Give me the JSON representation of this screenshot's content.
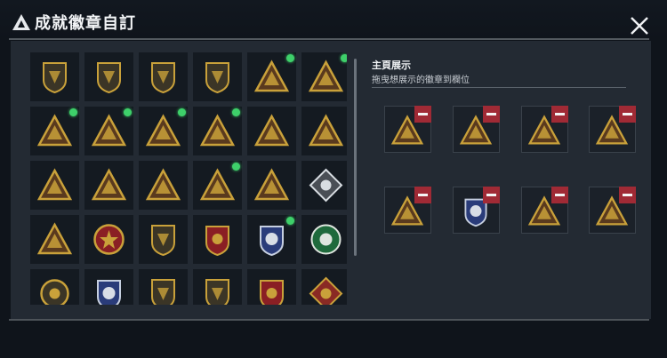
{
  "header": {
    "title": "成就徽章自訂"
  },
  "showcase": {
    "title": "主頁展示",
    "subtitle": "拖曳想展示的徽章到欄位"
  },
  "colors": {
    "gold": "#c9a13a",
    "panel": "#232a33",
    "new_dot": "#3ed06a",
    "remove": "#a02a35"
  },
  "badge_grid": [
    {
      "icon": "shield-delta-icon",
      "new": false
    },
    {
      "icon": "shield-helicopter-icon",
      "new": false
    },
    {
      "icon": "shield-diamond-icon",
      "new": false
    },
    {
      "icon": "shield-arrows-icon",
      "new": false
    },
    {
      "icon": "triangle-trophy-56-icon",
      "new": true
    },
    {
      "icon": "triangle-canister-icon",
      "new": true
    },
    {
      "icon": "triangle-card-56-icon",
      "new": true
    },
    {
      "icon": "triangle-turret-icon",
      "new": true
    },
    {
      "icon": "triangle-chain-icon",
      "new": true
    },
    {
      "icon": "triangle-helmet-icon",
      "new": true
    },
    {
      "icon": "triangle-number-one-icon",
      "new": false
    },
    {
      "icon": "triangle-bag-icon",
      "new": false
    },
    {
      "icon": "triangle-soldier-icon",
      "new": false
    },
    {
      "icon": "triangle-crosshair-icon",
      "new": false
    },
    {
      "icon": "triangle-squad-icon",
      "new": false
    },
    {
      "icon": "triangle-rocket-icon",
      "new": true
    },
    {
      "icon": "triangle-arm-icon",
      "new": false
    },
    {
      "icon": "diamond-skull-icon",
      "new": false
    },
    {
      "icon": "triangle-gunner-icon",
      "new": false
    },
    {
      "icon": "round-star-medal-icon",
      "new": false
    },
    {
      "icon": "shield-plate-icon",
      "new": false
    },
    {
      "icon": "shield-star-crest-icon",
      "new": false
    },
    {
      "icon": "shield-blue-eagle-icon",
      "new": true
    },
    {
      "icon": "round-green-medal-icon",
      "new": false
    },
    {
      "icon": "round-sunburst-icon",
      "new": false
    },
    {
      "icon": "shield-blue-wings-icon",
      "new": false
    },
    {
      "icon": "shield-prohibited-icon",
      "new": false
    },
    {
      "icon": "shield-prohibited-gold-icon",
      "new": false
    },
    {
      "icon": "shield-winged-crest-icon",
      "new": false
    },
    {
      "icon": "diamond-red-emblem-icon",
      "new": false
    }
  ],
  "showcase_slots": [
    {
      "icon": "triangle-chain-icon"
    },
    {
      "icon": "triangle-trophy-56-icon"
    },
    {
      "icon": "triangle-canister-icon"
    },
    {
      "icon": "triangle-card-56-icon"
    },
    {
      "icon": "triangle-rocket-icon"
    },
    {
      "icon": "shield-blue-eagle-icon"
    },
    {
      "icon": "triangle-helmet-icon"
    },
    {
      "icon": "triangle-turret-icon"
    }
  ]
}
